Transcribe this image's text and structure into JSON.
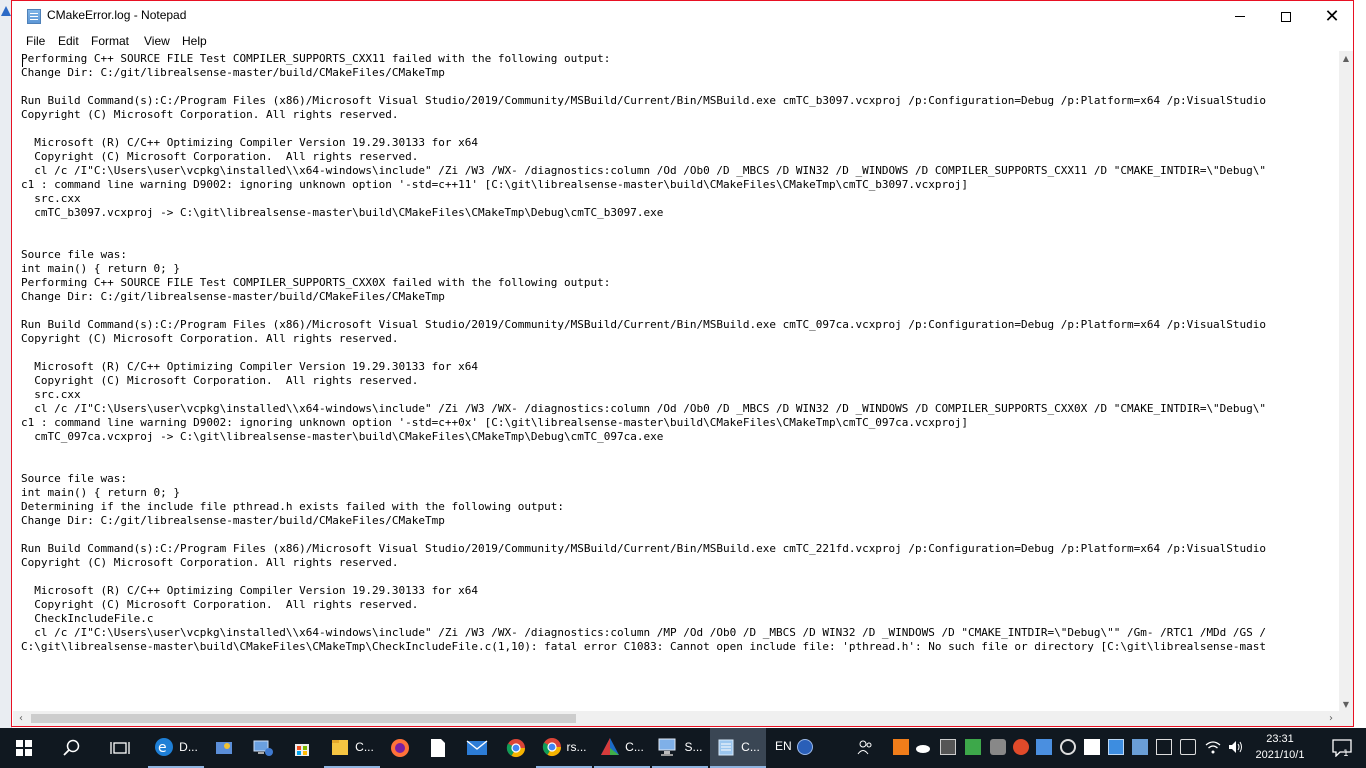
{
  "window": {
    "title": "CMakeError.log - Notepad"
  },
  "menu": {
    "file": "File",
    "edit": "Edit",
    "format": "Format",
    "view": "View",
    "help": "Help"
  },
  "document": {
    "text": "Performing C++ SOURCE FILE Test COMPILER_SUPPORTS_CXX11 failed with the following output:\nChange Dir: C:/git/librealsense-master/build/CMakeFiles/CMakeTmp\n\nRun Build Command(s):C:/Program Files (x86)/Microsoft Visual Studio/2019/Community/MSBuild/Current/Bin/MSBuild.exe cmTC_b3097.vcxproj /p:Configuration=Debug /p:Platform=x64 /p:VisualStudio\nCopyright (C) Microsoft Corporation. All rights reserved.\n\n  Microsoft (R) C/C++ Optimizing Compiler Version 19.29.30133 for x64\n  Copyright (C) Microsoft Corporation.  All rights reserved.\n  cl /c /I\"C:\\Users\\user\\vcpkg\\installed\\\\x64-windows\\include\" /Zi /W3 /WX- /diagnostics:column /Od /Ob0 /D _MBCS /D WIN32 /D _WINDOWS /D COMPILER_SUPPORTS_CXX11 /D \"CMAKE_INTDIR=\\\"Debug\\\"\nc1 : command line warning D9002: ignoring unknown option '-std=c++11' [C:\\git\\librealsense-master\\build\\CMakeFiles\\CMakeTmp\\cmTC_b3097.vcxproj]\n  src.cxx\n  cmTC_b3097.vcxproj -> C:\\git\\librealsense-master\\build\\CMakeFiles\\CMakeTmp\\Debug\\cmTC_b3097.exe\n\n\nSource file was:\nint main() { return 0; }\nPerforming C++ SOURCE FILE Test COMPILER_SUPPORTS_CXX0X failed with the following output:\nChange Dir: C:/git/librealsense-master/build/CMakeFiles/CMakeTmp\n\nRun Build Command(s):C:/Program Files (x86)/Microsoft Visual Studio/2019/Community/MSBuild/Current/Bin/MSBuild.exe cmTC_097ca.vcxproj /p:Configuration=Debug /p:Platform=x64 /p:VisualStudio\nCopyright (C) Microsoft Corporation. All rights reserved.\n\n  Microsoft (R) C/C++ Optimizing Compiler Version 19.29.30133 for x64\n  Copyright (C) Microsoft Corporation.  All rights reserved.\n  src.cxx\n  cl /c /I\"C:\\Users\\user\\vcpkg\\installed\\\\x64-windows\\include\" /Zi /W3 /WX- /diagnostics:column /Od /Ob0 /D _MBCS /D WIN32 /D _WINDOWS /D COMPILER_SUPPORTS_CXX0X /D \"CMAKE_INTDIR=\\\"Debug\\\"\nc1 : command line warning D9002: ignoring unknown option '-std=c++0x' [C:\\git\\librealsense-master\\build\\CMakeFiles\\CMakeTmp\\cmTC_097ca.vcxproj]\n  cmTC_097ca.vcxproj -> C:\\git\\librealsense-master\\build\\CMakeFiles\\CMakeTmp\\Debug\\cmTC_097ca.exe\n\n\nSource file was:\nint main() { return 0; }\nDetermining if the include file pthread.h exists failed with the following output:\nChange Dir: C:/git/librealsense-master/build/CMakeFiles/CMakeTmp\n\nRun Build Command(s):C:/Program Files (x86)/Microsoft Visual Studio/2019/Community/MSBuild/Current/Bin/MSBuild.exe cmTC_221fd.vcxproj /p:Configuration=Debug /p:Platform=x64 /p:VisualStudio\nCopyright (C) Microsoft Corporation. All rights reserved.\n\n  Microsoft (R) C/C++ Optimizing Compiler Version 19.29.30133 for x64\n  Copyright (C) Microsoft Corporation.  All rights reserved.\n  CheckIncludeFile.c\n  cl /c /I\"C:\\Users\\user\\vcpkg\\installed\\\\x64-windows\\include\" /Zi /W3 /WX- /diagnostics:column /MP /Od /Ob0 /D _MBCS /D WIN32 /D _WINDOWS /D \"CMAKE_INTDIR=\\\"Debug\\\"\" /Gm- /RTC1 /MDd /GS /\nC:\\git\\librealsense-master\\build\\CMakeFiles\\CMakeTmp\\CheckIncludeFile.c(1,10): fatal error C1083: Cannot open include file: 'pthread.h': No such file or directory [C:\\git\\librealsense-mast"
  },
  "taskbar": {
    "edge_label": "D...",
    "app3_label": "C...",
    "app4_label": "rs...",
    "app5_label": "C...",
    "app6_label": "S...",
    "notepad_label": "C..."
  },
  "tray": {
    "language": "EN",
    "time": "23:31",
    "date": "2021/10/1",
    "notification_count": "1"
  },
  "colors": {
    "window_border": "#e81123",
    "taskbar_bg": "#101820",
    "active_accent": "#8fb4e0"
  },
  "icons": [
    "windows-start-icon",
    "search-icon",
    "task-view-icon",
    "edge-icon",
    "file-explorer-icon",
    "store-icon",
    "firefox-icon",
    "notepad-icon",
    "mail-icon",
    "chrome-icon",
    "cmake-icon",
    "people-icon",
    "wifi-icon",
    "volume-icon",
    "notification-icon"
  ]
}
